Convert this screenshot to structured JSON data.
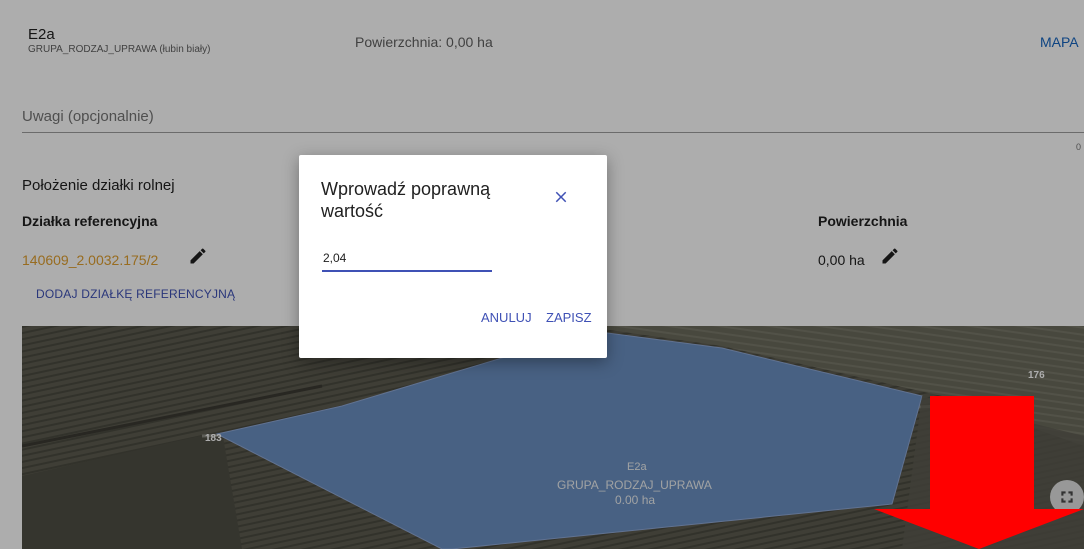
{
  "record": {
    "code": "E2a",
    "group": "GRUPA_RODZAJ_UPRAWA (łubin biały)",
    "area": "Powierzchnia: 0,00 ha",
    "map_link": "MAPA"
  },
  "notes": {
    "placeholder": "Uwagi (opcjonalnie)",
    "counter": "0"
  },
  "location": {
    "title": "Położenie działki rolnej",
    "ref_header": "Działka referencyjna",
    "area_header": "Powierzchnia",
    "parcel_id": "140609_2.0032.175/2",
    "area_value": "0,00 ha",
    "add_ref": "DODAJ DZIAŁKĘ REFERENCYJNĄ"
  },
  "map": {
    "neighbor_left": "183",
    "neighbor_right": "176",
    "polygon_code": "E2a",
    "polygon_group": "GRUPA_RODZAJ_UPRAWA",
    "polygon_area": "0.00 ha",
    "polygon_color": "#6b8fc1"
  },
  "dialog": {
    "title": "Wprowadź poprawną wartość",
    "input_value": "2,04",
    "cancel": "ANULUJ",
    "save": "ZAPISZ",
    "accent": "#3f51b5"
  },
  "icons": {
    "edit": "pencil-icon",
    "close": "close-icon",
    "fullscreen": "fullscreen-icon",
    "arrow": "down-arrow-icon"
  },
  "annotation": {
    "arrow_color": "#ff0000"
  }
}
